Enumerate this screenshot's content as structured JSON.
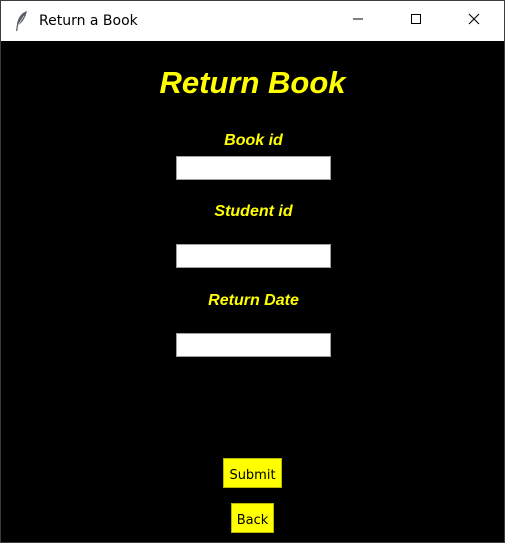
{
  "window": {
    "title": "Return a Book",
    "icons": {
      "app": "feather-icon",
      "minimize": "minimize-icon",
      "maximize": "maximize-icon",
      "close": "close-icon"
    }
  },
  "form": {
    "heading": "Return Book",
    "fields": [
      {
        "label": "Book id",
        "value": ""
      },
      {
        "label": "Student id",
        "value": ""
      },
      {
        "label": "Return Date",
        "value": ""
      }
    ]
  },
  "buttons": {
    "submit_label": "Submit",
    "back_label": "Back"
  },
  "colors": {
    "background": "#000000",
    "accent_text": "#ffff00",
    "button_bg": "#ffff00",
    "titlebar_bg": "#ffffff"
  }
}
